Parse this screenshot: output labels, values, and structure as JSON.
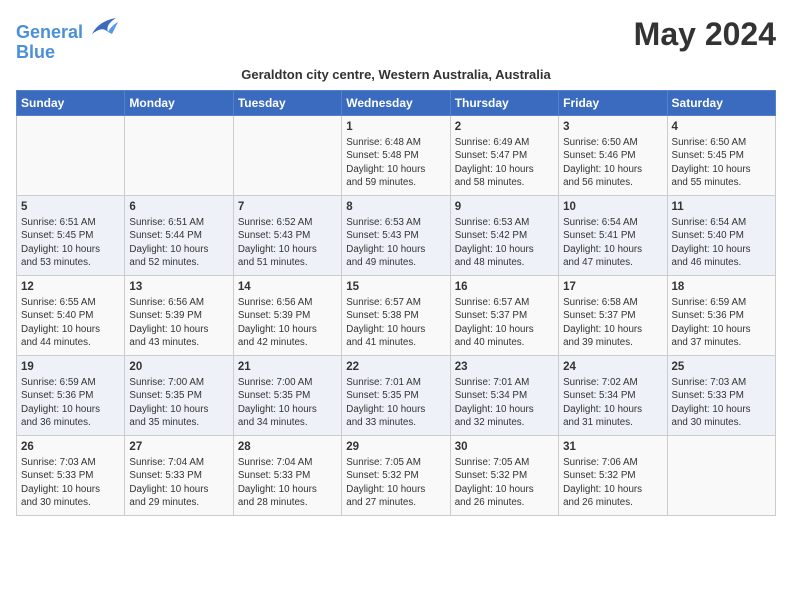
{
  "header": {
    "logo_line1": "General",
    "logo_line2": "Blue",
    "month_title": "May 2024",
    "subtitle": "Geraldton city centre, Western Australia, Australia"
  },
  "weekdays": [
    "Sunday",
    "Monday",
    "Tuesday",
    "Wednesday",
    "Thursday",
    "Friday",
    "Saturday"
  ],
  "weeks": [
    [
      {
        "day": "",
        "info": ""
      },
      {
        "day": "",
        "info": ""
      },
      {
        "day": "",
        "info": ""
      },
      {
        "day": "1",
        "info": "Sunrise: 6:48 AM\nSunset: 5:48 PM\nDaylight: 10 hours\nand 59 minutes."
      },
      {
        "day": "2",
        "info": "Sunrise: 6:49 AM\nSunset: 5:47 PM\nDaylight: 10 hours\nand 58 minutes."
      },
      {
        "day": "3",
        "info": "Sunrise: 6:50 AM\nSunset: 5:46 PM\nDaylight: 10 hours\nand 56 minutes."
      },
      {
        "day": "4",
        "info": "Sunrise: 6:50 AM\nSunset: 5:45 PM\nDaylight: 10 hours\nand 55 minutes."
      }
    ],
    [
      {
        "day": "5",
        "info": "Sunrise: 6:51 AM\nSunset: 5:45 PM\nDaylight: 10 hours\nand 53 minutes."
      },
      {
        "day": "6",
        "info": "Sunrise: 6:51 AM\nSunset: 5:44 PM\nDaylight: 10 hours\nand 52 minutes."
      },
      {
        "day": "7",
        "info": "Sunrise: 6:52 AM\nSunset: 5:43 PM\nDaylight: 10 hours\nand 51 minutes."
      },
      {
        "day": "8",
        "info": "Sunrise: 6:53 AM\nSunset: 5:43 PM\nDaylight: 10 hours\nand 49 minutes."
      },
      {
        "day": "9",
        "info": "Sunrise: 6:53 AM\nSunset: 5:42 PM\nDaylight: 10 hours\nand 48 minutes."
      },
      {
        "day": "10",
        "info": "Sunrise: 6:54 AM\nSunset: 5:41 PM\nDaylight: 10 hours\nand 47 minutes."
      },
      {
        "day": "11",
        "info": "Sunrise: 6:54 AM\nSunset: 5:40 PM\nDaylight: 10 hours\nand 46 minutes."
      }
    ],
    [
      {
        "day": "12",
        "info": "Sunrise: 6:55 AM\nSunset: 5:40 PM\nDaylight: 10 hours\nand 44 minutes."
      },
      {
        "day": "13",
        "info": "Sunrise: 6:56 AM\nSunset: 5:39 PM\nDaylight: 10 hours\nand 43 minutes."
      },
      {
        "day": "14",
        "info": "Sunrise: 6:56 AM\nSunset: 5:39 PM\nDaylight: 10 hours\nand 42 minutes."
      },
      {
        "day": "15",
        "info": "Sunrise: 6:57 AM\nSunset: 5:38 PM\nDaylight: 10 hours\nand 41 minutes."
      },
      {
        "day": "16",
        "info": "Sunrise: 6:57 AM\nSunset: 5:37 PM\nDaylight: 10 hours\nand 40 minutes."
      },
      {
        "day": "17",
        "info": "Sunrise: 6:58 AM\nSunset: 5:37 PM\nDaylight: 10 hours\nand 39 minutes."
      },
      {
        "day": "18",
        "info": "Sunrise: 6:59 AM\nSunset: 5:36 PM\nDaylight: 10 hours\nand 37 minutes."
      }
    ],
    [
      {
        "day": "19",
        "info": "Sunrise: 6:59 AM\nSunset: 5:36 PM\nDaylight: 10 hours\nand 36 minutes."
      },
      {
        "day": "20",
        "info": "Sunrise: 7:00 AM\nSunset: 5:35 PM\nDaylight: 10 hours\nand 35 minutes."
      },
      {
        "day": "21",
        "info": "Sunrise: 7:00 AM\nSunset: 5:35 PM\nDaylight: 10 hours\nand 34 minutes."
      },
      {
        "day": "22",
        "info": "Sunrise: 7:01 AM\nSunset: 5:35 PM\nDaylight: 10 hours\nand 33 minutes."
      },
      {
        "day": "23",
        "info": "Sunrise: 7:01 AM\nSunset: 5:34 PM\nDaylight: 10 hours\nand 32 minutes."
      },
      {
        "day": "24",
        "info": "Sunrise: 7:02 AM\nSunset: 5:34 PM\nDaylight: 10 hours\nand 31 minutes."
      },
      {
        "day": "25",
        "info": "Sunrise: 7:03 AM\nSunset: 5:33 PM\nDaylight: 10 hours\nand 30 minutes."
      }
    ],
    [
      {
        "day": "26",
        "info": "Sunrise: 7:03 AM\nSunset: 5:33 PM\nDaylight: 10 hours\nand 30 minutes."
      },
      {
        "day": "27",
        "info": "Sunrise: 7:04 AM\nSunset: 5:33 PM\nDaylight: 10 hours\nand 29 minutes."
      },
      {
        "day": "28",
        "info": "Sunrise: 7:04 AM\nSunset: 5:33 PM\nDaylight: 10 hours\nand 28 minutes."
      },
      {
        "day": "29",
        "info": "Sunrise: 7:05 AM\nSunset: 5:32 PM\nDaylight: 10 hours\nand 27 minutes."
      },
      {
        "day": "30",
        "info": "Sunrise: 7:05 AM\nSunset: 5:32 PM\nDaylight: 10 hours\nand 26 minutes."
      },
      {
        "day": "31",
        "info": "Sunrise: 7:06 AM\nSunset: 5:32 PM\nDaylight: 10 hours\nand 26 minutes."
      },
      {
        "day": "",
        "info": ""
      }
    ]
  ]
}
